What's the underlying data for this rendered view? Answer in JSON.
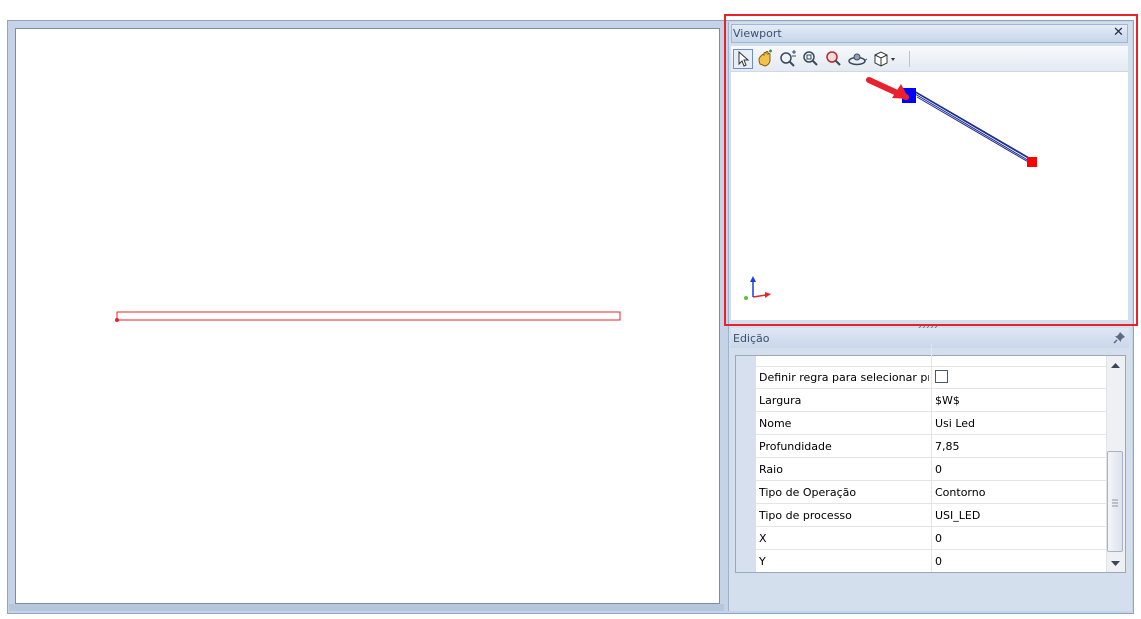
{
  "viewport": {
    "title": "Viewport",
    "close_glyph": "✕",
    "toolbar": [
      "select-arrow-icon",
      "pan-hand-icon",
      "zoom-in-out-icon",
      "zoom-window-icon",
      "zoom-extents-icon",
      "orbit-icon",
      "view-cube-icon"
    ]
  },
  "edicao": {
    "title": "Edição",
    "rows": [
      {
        "name": "Definir regra para selecionar pro...",
        "checkbox": true,
        "checked": false
      },
      {
        "name": "Largura",
        "value": "$W$"
      },
      {
        "name": "Nome",
        "value": "Usi Led"
      },
      {
        "name": "Profundidade",
        "value": "7,85"
      },
      {
        "name": "Raio",
        "value": "0"
      },
      {
        "name": "Tipo de Operação",
        "value": "Contorno"
      },
      {
        "name": "Tipo de processo",
        "value": "USI_LED"
      },
      {
        "name": "X",
        "value": "0"
      },
      {
        "name": "Y",
        "value": "0"
      }
    ]
  },
  "colors": {
    "highlight_box": "#e8212c",
    "shape_outline": "#e8212c",
    "viewport_line": "#1a2a8f",
    "start_marker": "#0000ff",
    "end_marker": "#ff0000"
  }
}
